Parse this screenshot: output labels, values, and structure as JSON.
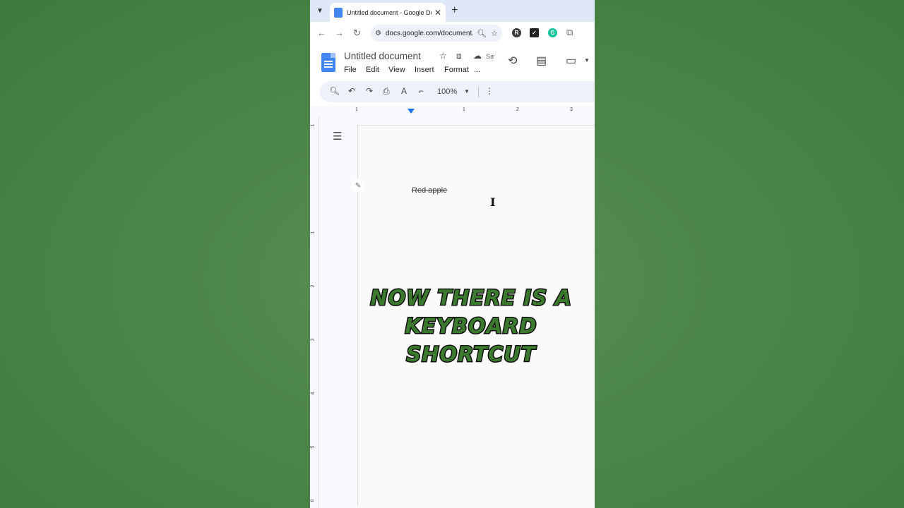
{
  "tab": {
    "title": "Untitled document - Google Docs"
  },
  "address": {
    "url": "docs.google.com/document/d/"
  },
  "docs": {
    "title": "Untitled document",
    "saved_status": "Saved",
    "menu": [
      "File",
      "Edit",
      "View",
      "Insert",
      "Format",
      "..."
    ]
  },
  "toolbar": {
    "zoom": "100%"
  },
  "ruler": {
    "numbers": [
      "1",
      "1",
      "2",
      "3"
    ],
    "vertical_numbers": [
      "1",
      "1",
      "2",
      "3",
      "4",
      "5",
      "6"
    ]
  },
  "document": {
    "text": "Red apple"
  },
  "overlay": {
    "caption": "Now there is a keyboard shortcut"
  },
  "colors": {
    "background": "#4c8548",
    "caption_fill": "#3b7a2e",
    "docs_blue": "#4285f4"
  }
}
